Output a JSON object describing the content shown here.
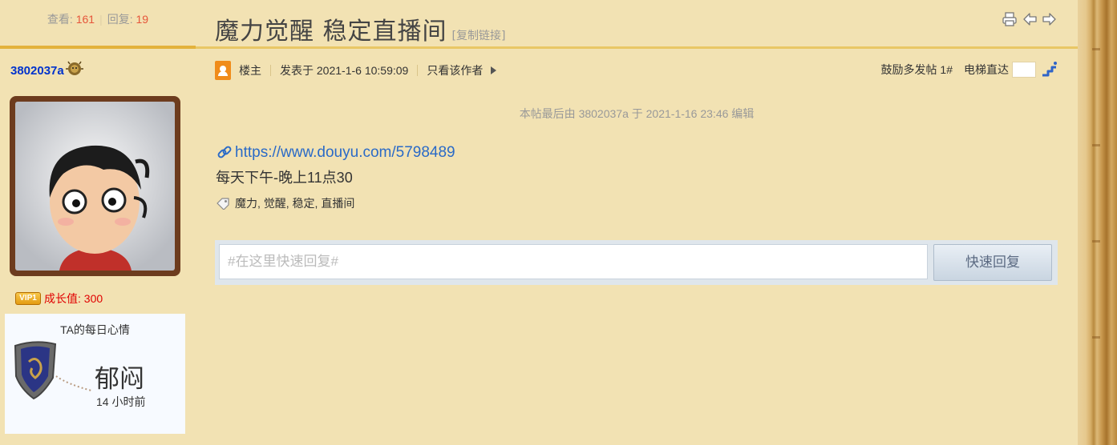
{
  "sidebar": {
    "views_label": "查看:",
    "views": "161",
    "replies_label": "回复:",
    "replies": "19",
    "username": "3802037a",
    "vip_tag": "VIP1",
    "growth": "成长值: 300",
    "mood": {
      "title": "TA的每日心情",
      "word": "郁闷",
      "time": "14 小时前"
    }
  },
  "header": {
    "title": "魔力觉醒 稳定直播间",
    "copy_link": "[复制链接]",
    "icons": [
      "print-icon",
      "prev-thread-icon",
      "next-thread-icon"
    ]
  },
  "post": {
    "role": "楼主",
    "posted": "发表于 2021-1-6 10:59:09",
    "only_author": "只看该作者",
    "floor": "鼓励多发帖 1#",
    "elevator": "电梯直达",
    "edit_note": "本帖最后由 3802037a 于 2021-1-16 23:46 编辑",
    "link": "https://www.douyu.com/5798489",
    "line2": "每天下午-晚上11点30",
    "tags": "魔力, 觉醒, 稳定, 直播间"
  },
  "reply": {
    "placeholder": "#在这里快速回复#",
    "button": "快速回复"
  },
  "colors": {
    "background": "#f2e2b3",
    "accent_rule": "#e3b23c",
    "link": "#2a6ac7",
    "count": "#e6553a",
    "username": "#0033cc"
  }
}
